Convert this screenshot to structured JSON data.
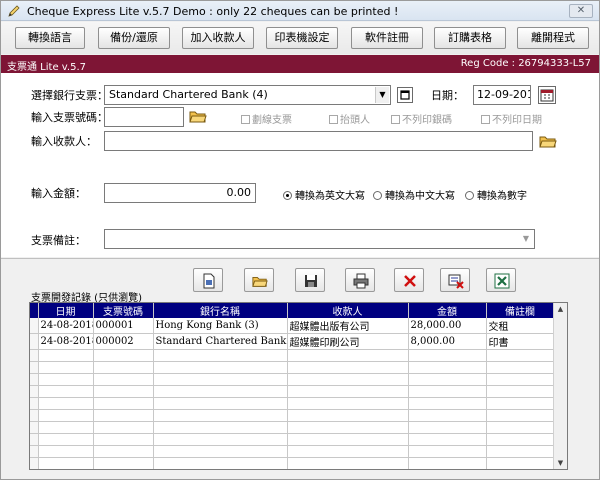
{
  "window": {
    "title": "Cheque Express Lite v.5.7 Demo : only 22 cheques can be printed !",
    "close_label": "✕"
  },
  "toolbar": [
    {
      "label": "轉換語言"
    },
    {
      "label": "備份/還原"
    },
    {
      "label": "加入收款人"
    },
    {
      "label": "印表機設定"
    },
    {
      "label": "軟件註冊"
    },
    {
      "label": "訂購表格"
    },
    {
      "label": "離開程式"
    }
  ],
  "banner": {
    "left": "支票通 Lite v.5.7",
    "right": "Reg Code : 26794333-L57"
  },
  "form": {
    "bank_label": "選擇銀行支票：",
    "bank_value": "Standard Chartered Bank (4)",
    "date_label": "日期：",
    "date_value": "12-09-2018",
    "cheque_no_label": "輸入支票號碼：",
    "cheque_no_value": "",
    "options": [
      "劃線支票",
      "抬頭人",
      "不列印銀碼",
      "不列印日期"
    ],
    "payee_label": "輸入收款人：",
    "payee_value": "",
    "amount_label": "輸入金額：",
    "amount_value": "0.00",
    "convert_options": [
      {
        "label": "轉換為英文大寫",
        "selected": true
      },
      {
        "label": "轉換為中文大寫",
        "selected": false
      },
      {
        "label": "轉換為數字",
        "selected": false
      }
    ],
    "remark_label": "支票備註：",
    "remark_value": ""
  },
  "history": {
    "label": "支票開發記錄 (只供瀏覽)",
    "columns": [
      "日期",
      "支票號碼",
      "銀行名稱",
      "收款人",
      "金額",
      "備註欄"
    ],
    "rows": [
      [
        "24-08-2018",
        "000001",
        "Hong Kong Bank (3)",
        "超媒體出版有公司",
        "28,000.00",
        "交租"
      ],
      [
        "24-08-2018",
        "000002",
        "Standard Chartered Bank (4)",
        "超媒體印刷公司",
        "8,000.00",
        "印書"
      ]
    ]
  },
  "icons": [
    "new-document-icon",
    "open-folder-icon",
    "save-disk-icon",
    "printer-icon",
    "delete-x-icon",
    "clear-list-icon",
    "excel-export-icon"
  ],
  "colors": {
    "banner": "#7e1535",
    "grid_header": "#000080"
  }
}
